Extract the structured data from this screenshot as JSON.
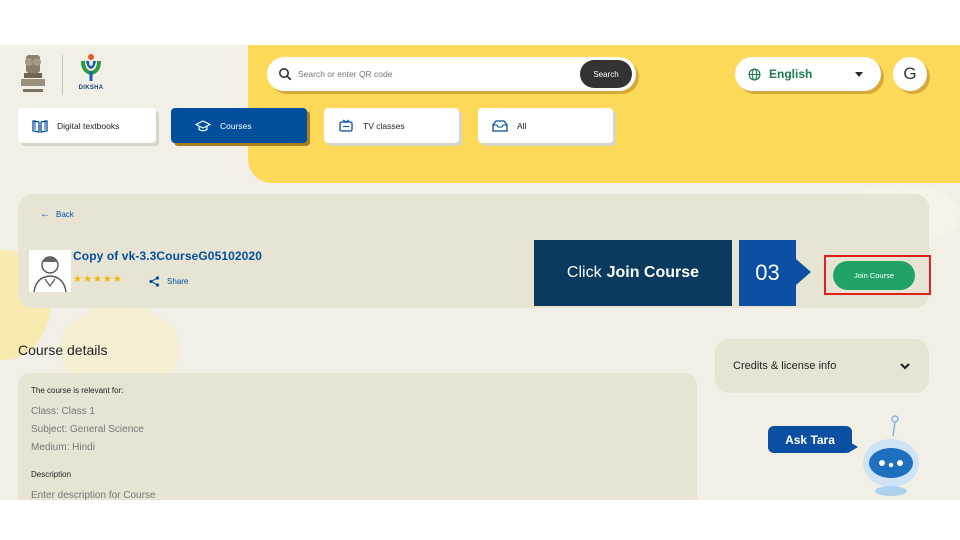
{
  "brand": {
    "name": "DIKSHA"
  },
  "search": {
    "placeholder": "Search or enter QR code",
    "button_label": "Search"
  },
  "language": {
    "selected": "English"
  },
  "user": {
    "initial": "G"
  },
  "tabs": [
    {
      "label": "Digital textbooks",
      "icon": "book-icon",
      "active": false
    },
    {
      "label": "Courses",
      "icon": "graduation-cap-icon",
      "active": true
    },
    {
      "label": "TV classes",
      "icon": "tv-icon",
      "active": false
    },
    {
      "label": "All",
      "icon": "inbox-icon",
      "active": false
    }
  ],
  "course": {
    "back_label": "Back",
    "title": "Copy of vk-3.3CourseG05102020",
    "rating": 5,
    "share_label": "Share",
    "join_label": "Join Course"
  },
  "callout": {
    "prefix": "Click",
    "emphasis": "Join Course",
    "step": "03"
  },
  "details": {
    "heading": "Course details",
    "relevant_label": "The course is relevant for:",
    "class_line": "Class: Class 1",
    "subject_line": "Subject: General Science",
    "medium_line": "Medium: Hindi",
    "description_label": "Description",
    "description_text": "Enter description for Course"
  },
  "credits": {
    "label": "Credits & license info"
  },
  "assistant": {
    "label": "Ask Tara"
  },
  "colors": {
    "primary": "#024f9d",
    "accent_yellow": "#fdd95a",
    "join_green": "#21a366",
    "highlight_red": "#e0201a",
    "callout_bg": "#0b3a5f"
  }
}
